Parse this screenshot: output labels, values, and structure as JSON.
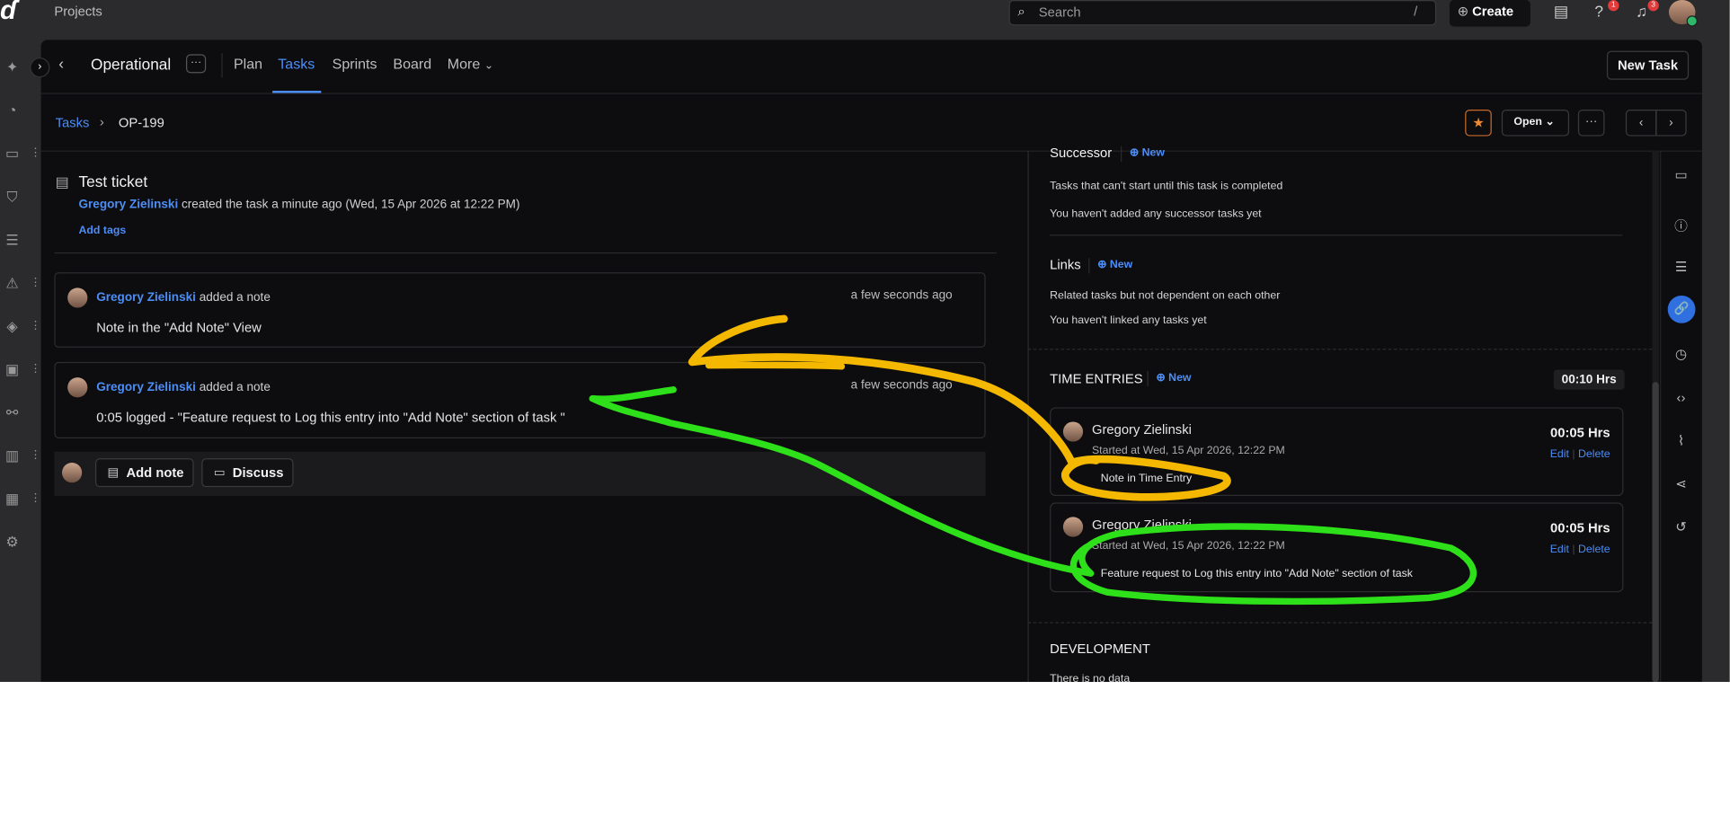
{
  "topbar": {
    "projects_label": "Projects",
    "search_placeholder": "Search",
    "search_shortcut": "/",
    "create_label": "Create",
    "help_badge": "1",
    "notif_badge": "3"
  },
  "header": {
    "project_name": "Operational",
    "more_dots": "···",
    "tabs": [
      {
        "label": "Plan",
        "active": false
      },
      {
        "label": "Tasks",
        "active": true
      },
      {
        "label": "Sprints",
        "active": false
      },
      {
        "label": "Board",
        "active": false
      },
      {
        "label": "More",
        "active": false
      }
    ],
    "new_task_label": "New Task"
  },
  "breadcrumb": {
    "root": "Tasks",
    "separator": "›",
    "current": "OP-199"
  },
  "toolbar": {
    "status_label": "Open",
    "dots": "···"
  },
  "ticket": {
    "title": "Test ticket",
    "author": "Gregory Zielinski",
    "created_text": "created the task a minute ago (Wed, 15 Apr 2026 at 12:22 PM)",
    "add_tags_label": "Add tags"
  },
  "notes": [
    {
      "author": "Gregory Zielinski",
      "action": "added a note",
      "time": "a few seconds ago",
      "body": "Note in the \"Add Note\" View"
    },
    {
      "author": "Gregory Zielinski",
      "action": "added a note",
      "time": "a few seconds ago",
      "body": "0:05 logged - \"Feature request to Log this entry into \"Add Note\" section of task \""
    }
  ],
  "composer": {
    "add_note_label": "Add note",
    "discuss_label": "Discuss"
  },
  "right": {
    "successor": {
      "title": "Successor",
      "new_label": "New",
      "desc": "Tasks that can't start until this task is completed",
      "empty": "You haven't added any successor tasks yet"
    },
    "links": {
      "title": "Links",
      "new_label": "New",
      "desc": "Related tasks but not dependent on each other",
      "empty": "You haven't linked any tasks yet"
    },
    "time_entries": {
      "title": "TIME ENTRIES",
      "new_label": "New",
      "total": "00:10 Hrs",
      "entries": [
        {
          "user": "Gregory Zielinski",
          "started": "Started at Wed, 15 Apr 2026, 12:22 PM",
          "hours": "00:05 Hrs",
          "edit": "Edit",
          "delete": "Delete",
          "note": "Note in Time Entry"
        },
        {
          "user": "Gregory Zielinski",
          "started": "Started at Wed, 15 Apr 2026, 12:22 PM",
          "hours": "00:05 Hrs",
          "edit": "Edit",
          "delete": "Delete",
          "note": "Feature request to Log this entry into \"Add Note\" section of task"
        }
      ]
    },
    "development": {
      "title": "DEVELOPMENT",
      "empty": "There is no data"
    }
  },
  "colors": {
    "accent": "#4c8df6",
    "annotation_yellow": "#f5b800",
    "annotation_green": "#2ee01a",
    "star": "#f08a34"
  }
}
